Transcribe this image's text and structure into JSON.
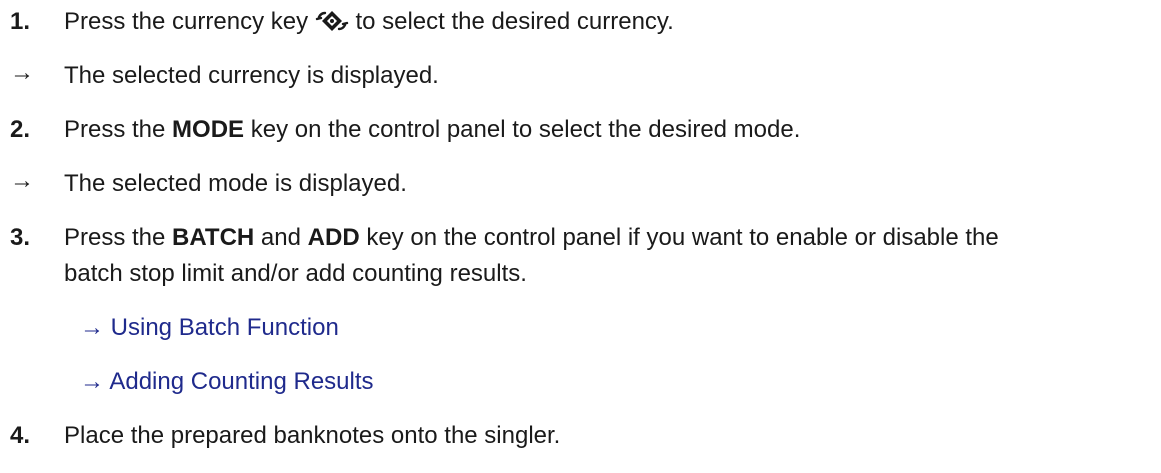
{
  "steps": [
    {
      "number": "1.",
      "pre": "Press the currency key",
      "icon": "currency-key-icon",
      "post": "to select the desired currency.",
      "result": "The selected currency is displayed."
    },
    {
      "number": "2.",
      "pre": "Press the ",
      "bold1": "MODE",
      "post": " key on the control panel to select the desired mode.",
      "result": "The selected mode is displayed."
    },
    {
      "number": "3.",
      "pre": "Press the ",
      "bold1": "BATCH",
      "mid": " and ",
      "bold2": "ADD",
      "post": " key on the control panel if you want to enable or disable the",
      "line2": "batch stop limit and/or add counting results.",
      "links": [
        {
          "label": "Using Batch Function"
        },
        {
          "label": "Adding Counting Results"
        }
      ]
    },
    {
      "number": "4.",
      "text": "Place the prepared banknotes onto the singler."
    }
  ],
  "arrow_glyph": "→",
  "colors": {
    "text": "#1a1a1a",
    "link": "#1f2a8c"
  }
}
